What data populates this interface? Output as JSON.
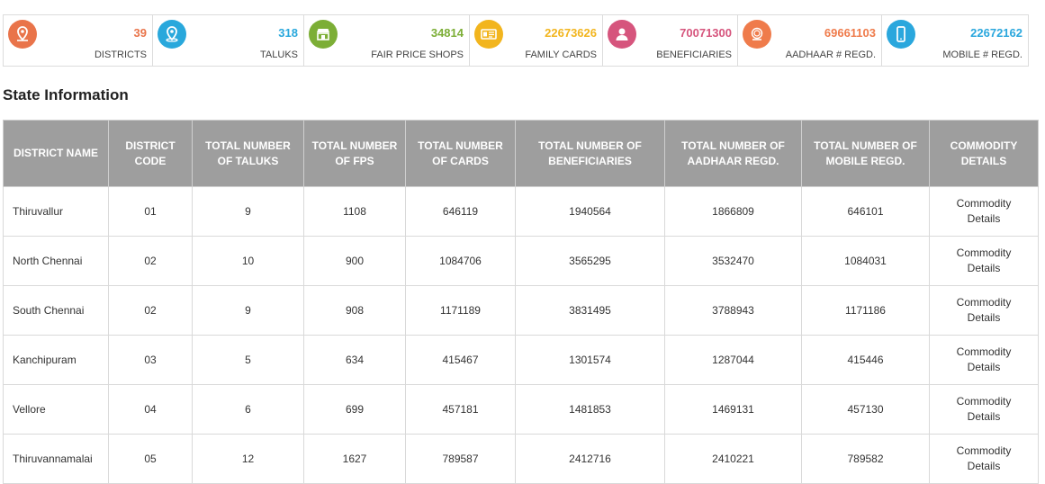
{
  "stats": [
    {
      "value": "39",
      "label": "DISTRICTS",
      "color": "#e9744a",
      "icon": "location-pin-icon"
    },
    {
      "value": "318",
      "label": "TALUKS",
      "color": "#29a8dc",
      "icon": "map-marker-icon"
    },
    {
      "value": "34814",
      "label": "FAIR PRICE SHOPS",
      "color": "#7cae36",
      "icon": "shop-icon"
    },
    {
      "value": "22673626",
      "label": "FAMILY CARDS",
      "color": "#f2b51e",
      "icon": "id-card-icon"
    },
    {
      "value": "70071300",
      "label": "BENEFICIARIES",
      "color": "#d6557d",
      "icon": "user-icon"
    },
    {
      "value": "69661103",
      "label": "AADHAAR # REGD.",
      "color": "#ef7b4b",
      "icon": "aadhaar-logo-icon"
    },
    {
      "value": "22672162",
      "label": "MOBILE # REGD.",
      "color": "#2aa7dd",
      "icon": "mobile-phone-icon"
    }
  ],
  "section_title": "State Information",
  "table": {
    "headers": [
      "DISTRICT NAME",
      "DISTRICT CODE",
      "TOTAL NUMBER OF TALUKS",
      "TOTAL NUMBER OF FPS",
      "TOTAL NUMBER OF CARDS",
      "TOTAL NUMBER OF BENEFICIARIES",
      "TOTAL NUMBER OF AADHAAR REGD.",
      "TOTAL NUMBER OF MOBILE REGD.",
      "COMMODITY DETAILS"
    ],
    "commodity_line1": "Commodity",
    "commodity_line2": "Details",
    "rows": [
      {
        "name": "Thiruvallur",
        "code": "01",
        "taluks": "9",
        "fps": "1108",
        "cards": "646119",
        "beneficiaries": "1940564",
        "aadhaar": "1866809",
        "mobile": "646101"
      },
      {
        "name": "North Chennai",
        "code": "02",
        "taluks": "10",
        "fps": "900",
        "cards": "1084706",
        "beneficiaries": "3565295",
        "aadhaar": "3532470",
        "mobile": "1084031"
      },
      {
        "name": "South Chennai",
        "code": "02",
        "taluks": "9",
        "fps": "908",
        "cards": "1171189",
        "beneficiaries": "3831495",
        "aadhaar": "3788943",
        "mobile": "1171186"
      },
      {
        "name": "Kanchipuram",
        "code": "03",
        "taluks": "5",
        "fps": "634",
        "cards": "415467",
        "beneficiaries": "1301574",
        "aadhaar": "1287044",
        "mobile": "415446"
      },
      {
        "name": "Vellore",
        "code": "04",
        "taluks": "6",
        "fps": "699",
        "cards": "457181",
        "beneficiaries": "1481853",
        "aadhaar": "1469131",
        "mobile": "457130"
      },
      {
        "name": "Thiruvannamalai",
        "code": "05",
        "taluks": "12",
        "fps": "1627",
        "cards": "789587",
        "beneficiaries": "2412716",
        "aadhaar": "2410221",
        "mobile": "789582"
      }
    ]
  }
}
